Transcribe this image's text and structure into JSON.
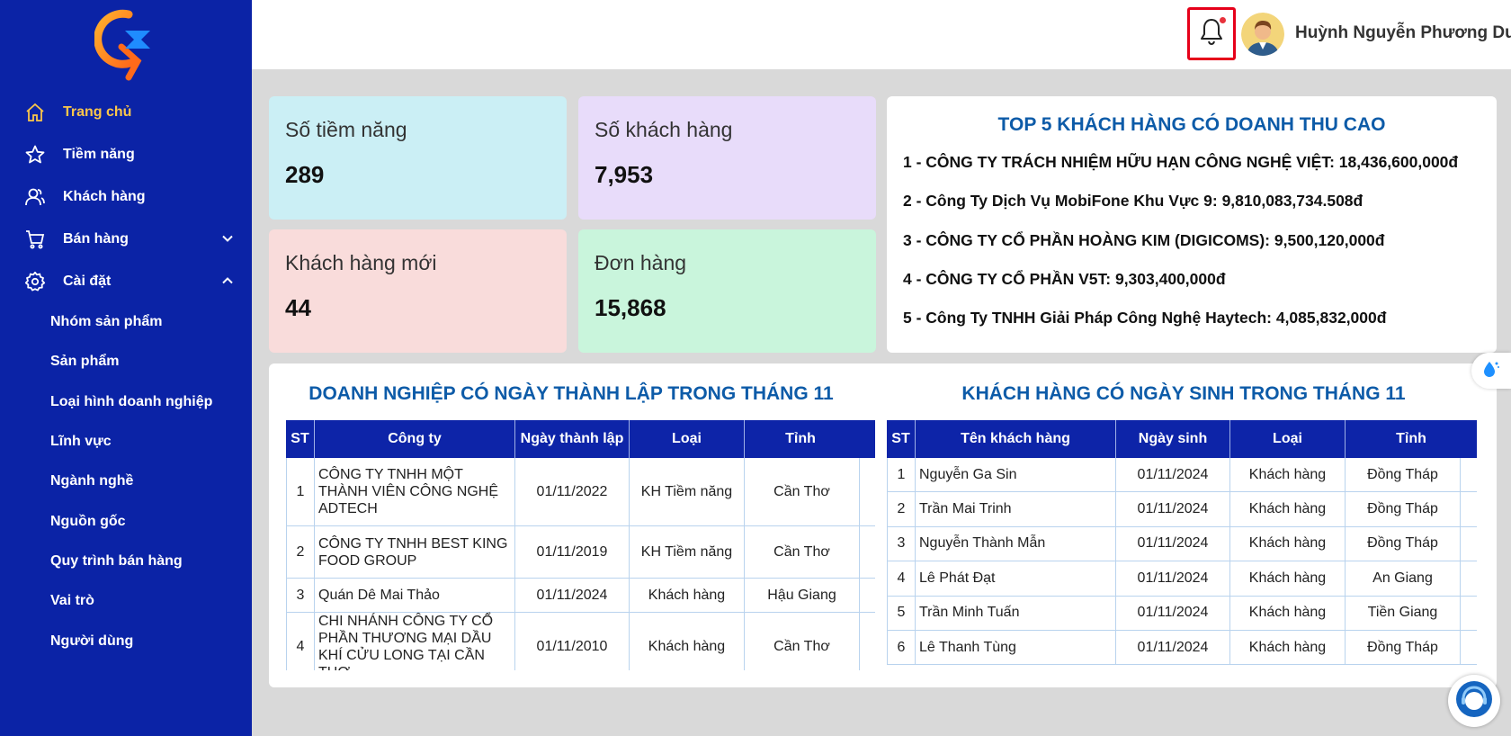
{
  "user": {
    "name": "Huỳnh Nguyễn Phương Duy"
  },
  "sidebar": {
    "items": [
      {
        "label": "Trang chủ",
        "icon": "home-icon",
        "active": true
      },
      {
        "label": "Tiềm năng",
        "icon": "star-icon"
      },
      {
        "label": "Khách hàng",
        "icon": "users-icon"
      },
      {
        "label": "Bán hàng",
        "icon": "cart-icon",
        "expand": "down"
      },
      {
        "label": "Cài đặt",
        "icon": "gear-icon",
        "expand": "up"
      }
    ],
    "sub_items": [
      "Nhóm sản phẩm",
      "Sản phẩm",
      "Loại hình doanh nghiệp",
      "Lĩnh vực",
      "Ngành nghề",
      "Nguồn gốc",
      "Quy trình bán hàng",
      "Vai trò",
      "Người dùng"
    ]
  },
  "stats": {
    "potential": {
      "label": "Số tiềm năng",
      "value": "289"
    },
    "customers": {
      "label": "Số khách hàng",
      "value": "7,953"
    },
    "new_customers": {
      "label": "Khách hàng mới",
      "value": "44"
    },
    "orders": {
      "label": "Đơn hàng",
      "value": "15,868"
    }
  },
  "colors": {
    "sidebar_bg": "#0b23a6",
    "active": "#fbc64a",
    "card_potential": "#cbeff5",
    "card_customers": "#e8dcfa",
    "card_new": "#f9dcdb",
    "card_orders": "#c9f5dc",
    "title_blue": "#0d5ba8"
  },
  "top5": {
    "title": "TOP 5 KHÁCH HÀNG CÓ DOANH THU CAO",
    "items": [
      "1 - CÔNG TY TRÁCH NHIỆM HỮU HẠN CÔNG NGHỆ VIỆT: 18,436,600,000đ",
      "2 - Công Ty Dịch Vụ MobiFone Khu Vực 9: 9,810,083,734.508đ",
      "3 - CÔNG TY CỔ PHẦN HOÀNG KIM (DIGICOMS): 9,500,120,000đ",
      "4 - CÔNG TY CỔ PHẦN V5T: 9,303,400,000đ",
      "5 - Công Ty TNHH Giải Pháp Công Nghệ Haytech: 4,085,832,000đ"
    ]
  },
  "companies": {
    "title": "DOANH NGHIỆP CÓ NGÀY THÀNH LẬP TRONG THÁNG 11",
    "headers": [
      "ST",
      "Công ty",
      "Ngày thành lập",
      "Loại",
      "Tỉnh"
    ],
    "rows": [
      [
        "1",
        "CÔNG TY TNHH MỘT THÀNH VIÊN CÔNG NGHỆ ADTECH",
        "01/11/2022",
        "KH Tiềm năng",
        "Cần Thơ"
      ],
      [
        "2",
        "CÔNG TY TNHH BEST KING FOOD GROUP",
        "01/11/2019",
        "KH Tiềm năng",
        "Cần Thơ"
      ],
      [
        "3",
        "Quán Dê Mai Thảo",
        "01/11/2024",
        "Khách hàng",
        "Hậu Giang"
      ],
      [
        "4",
        "CHI NHÁNH CÔNG TY CỔ PHẦN THƯƠNG MẠI DẦU KHÍ CỬU LONG TẠI CẦN THƠ",
        "01/11/2010",
        "Khách hàng",
        "Cần Thơ"
      ]
    ]
  },
  "birthdays": {
    "title": "KHÁCH HÀNG CÓ NGÀY SINH TRONG THÁNG 11",
    "headers": [
      "ST",
      "Tên khách hàng",
      "Ngày sinh",
      "Loại",
      "Tỉnh"
    ],
    "rows": [
      [
        "1",
        "Nguyễn Ga Sin",
        "01/11/2024",
        "Khách hàng",
        "Đồng Tháp"
      ],
      [
        "2",
        "Trần Mai Trinh",
        "01/11/2024",
        "Khách hàng",
        "Đồng Tháp"
      ],
      [
        "3",
        "Nguyễn Thành Mẫn",
        "01/11/2024",
        "Khách hàng",
        "Đồng Tháp"
      ],
      [
        "4",
        "Lê Phát Đạt",
        "01/11/2024",
        "Khách hàng",
        "An Giang"
      ],
      [
        "5",
        "Trần Minh Tuấn",
        "01/11/2024",
        "Khách hàng",
        "Tiền Giang"
      ],
      [
        "6",
        "Lê Thanh Tùng",
        "01/11/2024",
        "Khách hàng",
        "Đồng Tháp"
      ]
    ]
  }
}
